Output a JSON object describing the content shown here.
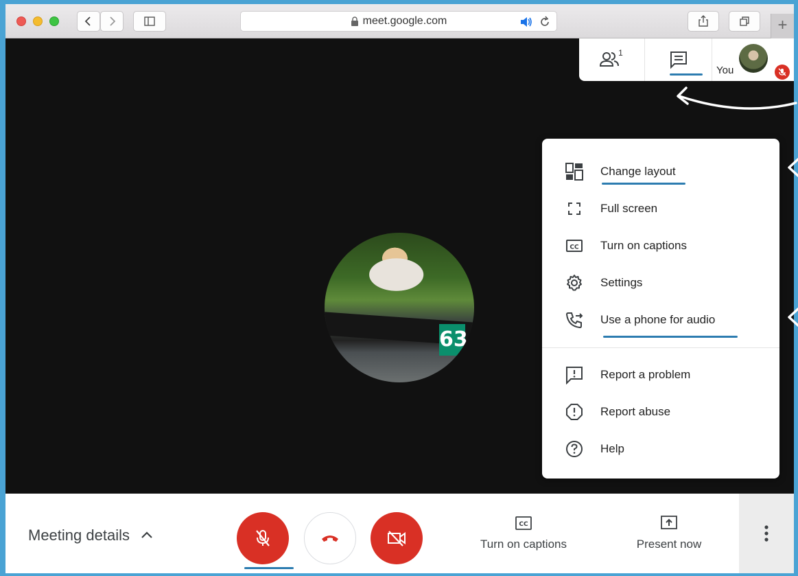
{
  "browser": {
    "url": "meet.google.com",
    "new_tab_label": "+"
  },
  "topbar": {
    "participant_count": "1",
    "you_label": "You"
  },
  "video": {
    "bib_number": "63"
  },
  "menu": {
    "items": [
      {
        "label": "Change layout",
        "icon": "change-layout-icon"
      },
      {
        "label": "Full screen",
        "icon": "fullscreen-icon"
      },
      {
        "label": "Turn on captions",
        "icon": "captions-icon"
      },
      {
        "label": "Settings",
        "icon": "gear-icon"
      },
      {
        "label": "Use a phone for audio",
        "icon": "phone-forward-icon"
      },
      {
        "label": "Report a problem",
        "icon": "feedback-icon"
      },
      {
        "label": "Report abuse",
        "icon": "alert-icon"
      },
      {
        "label": "Help",
        "icon": "help-icon"
      }
    ]
  },
  "bottombar": {
    "meeting_details": "Meeting details",
    "captions_label": "Turn on captions",
    "present_label": "Present now"
  },
  "colors": {
    "mute_red": "#d93025",
    "annotation_blue": "#2c7cb0",
    "frame_blue": "#4aa3d4"
  }
}
